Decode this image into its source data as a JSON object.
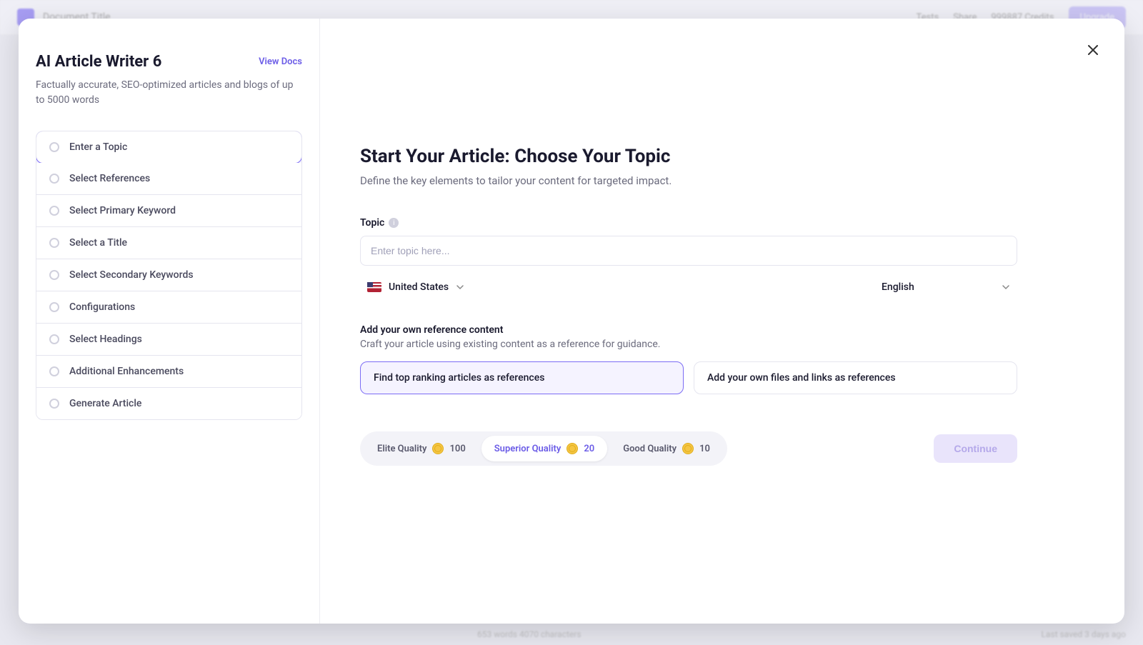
{
  "background": {
    "doc_title": "Document Title",
    "tests_link": "Tests",
    "share_link": "Share",
    "credits_text": "999887 Credits",
    "upgrade_btn": "Upgrade",
    "footer_center": "653 words   4070 characters",
    "footer_right": "Last saved 3 days ago"
  },
  "sidebar": {
    "title": "AI Article Writer 6",
    "view_docs": "View Docs",
    "subtitle": "Factually accurate, SEO-optimized articles and blogs of up to 5000 words",
    "steps": [
      {
        "label": "Enter a Topic",
        "active": true
      },
      {
        "label": "Select References",
        "active": false
      },
      {
        "label": "Select Primary Keyword",
        "active": false
      },
      {
        "label": "Select a Title",
        "active": false
      },
      {
        "label": "Select Secondary Keywords",
        "active": false
      },
      {
        "label": "Configurations",
        "active": false
      },
      {
        "label": "Select Headings",
        "active": false
      },
      {
        "label": "Additional Enhancements",
        "active": false
      },
      {
        "label": "Generate Article",
        "active": false
      }
    ]
  },
  "main": {
    "title": "Start Your Article: Choose Your Topic",
    "subtitle": "Define the key elements to tailor your content for targeted impact.",
    "topic_label": "Topic",
    "topic_placeholder": "Enter topic here...",
    "country": "United States",
    "language": "English",
    "ref_title": "Add your own reference content",
    "ref_subtitle": "Craft your article using existing content as a reference for guidance.",
    "ref_options": [
      {
        "label": "Find top ranking articles as references",
        "selected": true
      },
      {
        "label": "Add your own files and links as references",
        "selected": false
      }
    ],
    "quality": [
      {
        "label": "Elite Quality",
        "credits": "100",
        "active": false
      },
      {
        "label": "Superior Quality",
        "credits": "20",
        "active": true
      },
      {
        "label": "Good Quality",
        "credits": "10",
        "active": false
      }
    ],
    "continue_btn": "Continue"
  }
}
